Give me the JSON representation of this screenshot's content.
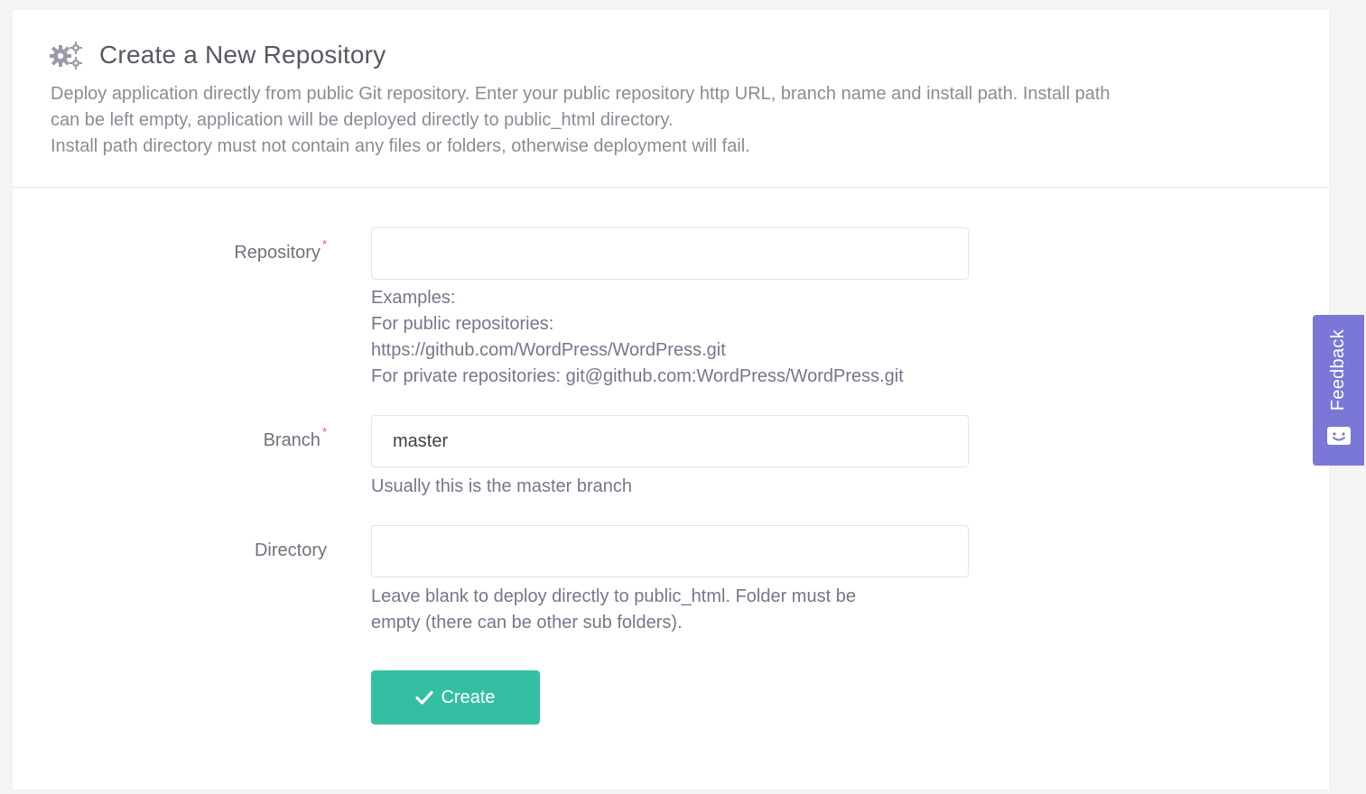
{
  "header": {
    "title": "Create a New Repository",
    "icon": "gears-icon",
    "description_lines": [
      "Deploy application directly from public Git repository. Enter your public repository http URL, branch name and install path. Install path",
      "can be left empty, application will be deployed directly to public_html directory.",
      "Install path directory must not contain any files or folders, otherwise deployment will fail."
    ]
  },
  "form": {
    "repository": {
      "label": "Repository",
      "required_mark": "*",
      "value": "",
      "help_lines": [
        "Examples:",
        "For public repositories:",
        "https://github.com/WordPress/WordPress.git",
        "For private repositories: git@github.com:WordPress/WordPress.git"
      ]
    },
    "branch": {
      "label": "Branch",
      "required_mark": "*",
      "value": "master",
      "help": "Usually this is the master branch"
    },
    "directory": {
      "label": "Directory",
      "value": "",
      "help_lines": [
        "Leave blank to deploy directly to public_html. Folder must be",
        "empty (there can be other sub folders)."
      ]
    },
    "submit": {
      "label": "Create",
      "icon": "check-icon"
    }
  },
  "feedback": {
    "label": "Feedback",
    "icon": "smile-chat-icon"
  },
  "colors": {
    "accent_green": "#34bfa3",
    "feedback_purple": "#7b77d6",
    "required_red": "#f4516c"
  }
}
